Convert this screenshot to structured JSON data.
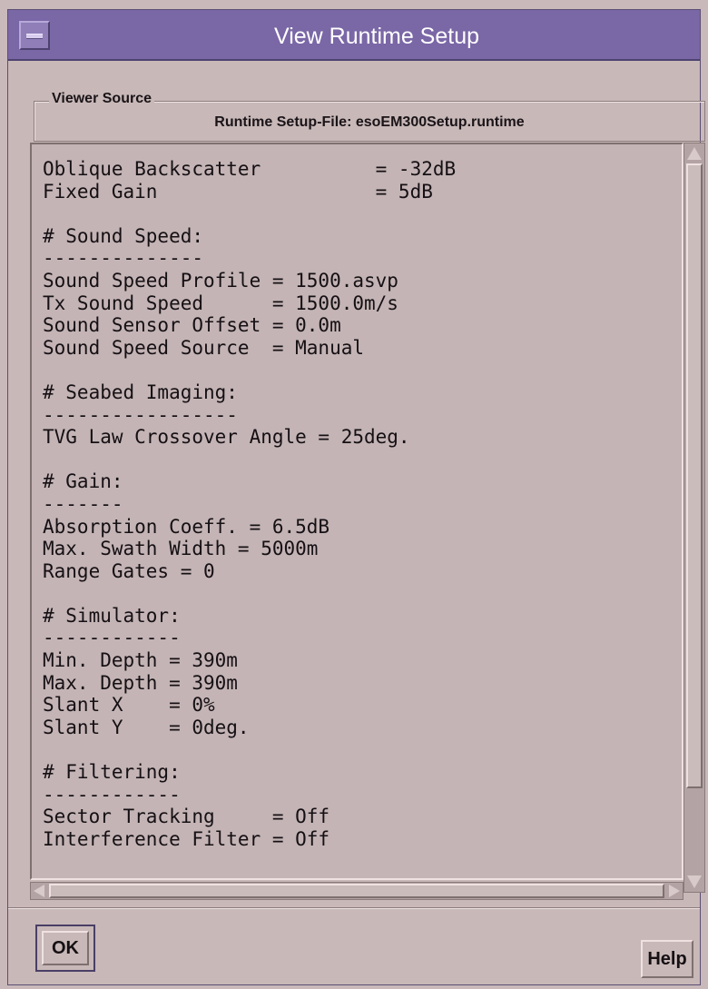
{
  "window": {
    "title": "View Runtime Setup"
  },
  "source_group": {
    "label": "Viewer Source",
    "value": "Runtime Setup-File: esoEM300Setup.runtime"
  },
  "content_lines": [
    "Oblique Backscatter          = -32dB",
    "Fixed Gain                   = 5dB",
    "",
    "# Sound Speed:",
    "--------------",
    "Sound Speed Profile = 1500.asvp",
    "Tx Sound Speed      = 1500.0m/s",
    "Sound Sensor Offset = 0.0m",
    "Sound Speed Source  = Manual",
    "",
    "# Seabed Imaging:",
    "-----------------",
    "TVG Law Crossover Angle = 25deg.",
    "",
    "# Gain:",
    "-------",
    "Absorption Coeff. = 6.5dB",
    "Max. Swath Width = 5000m",
    "Range Gates = 0",
    "",
    "# Simulator:",
    "------------",
    "Min. Depth = 390m",
    "Max. Depth = 390m",
    "Slant X    = 0%",
    "Slant Y    = 0deg.",
    "",
    "# Filtering:",
    "------------",
    "Sector Tracking     = Off",
    "Interference Filter = Off"
  ],
  "buttons": {
    "ok": "OK",
    "help": "Help"
  }
}
